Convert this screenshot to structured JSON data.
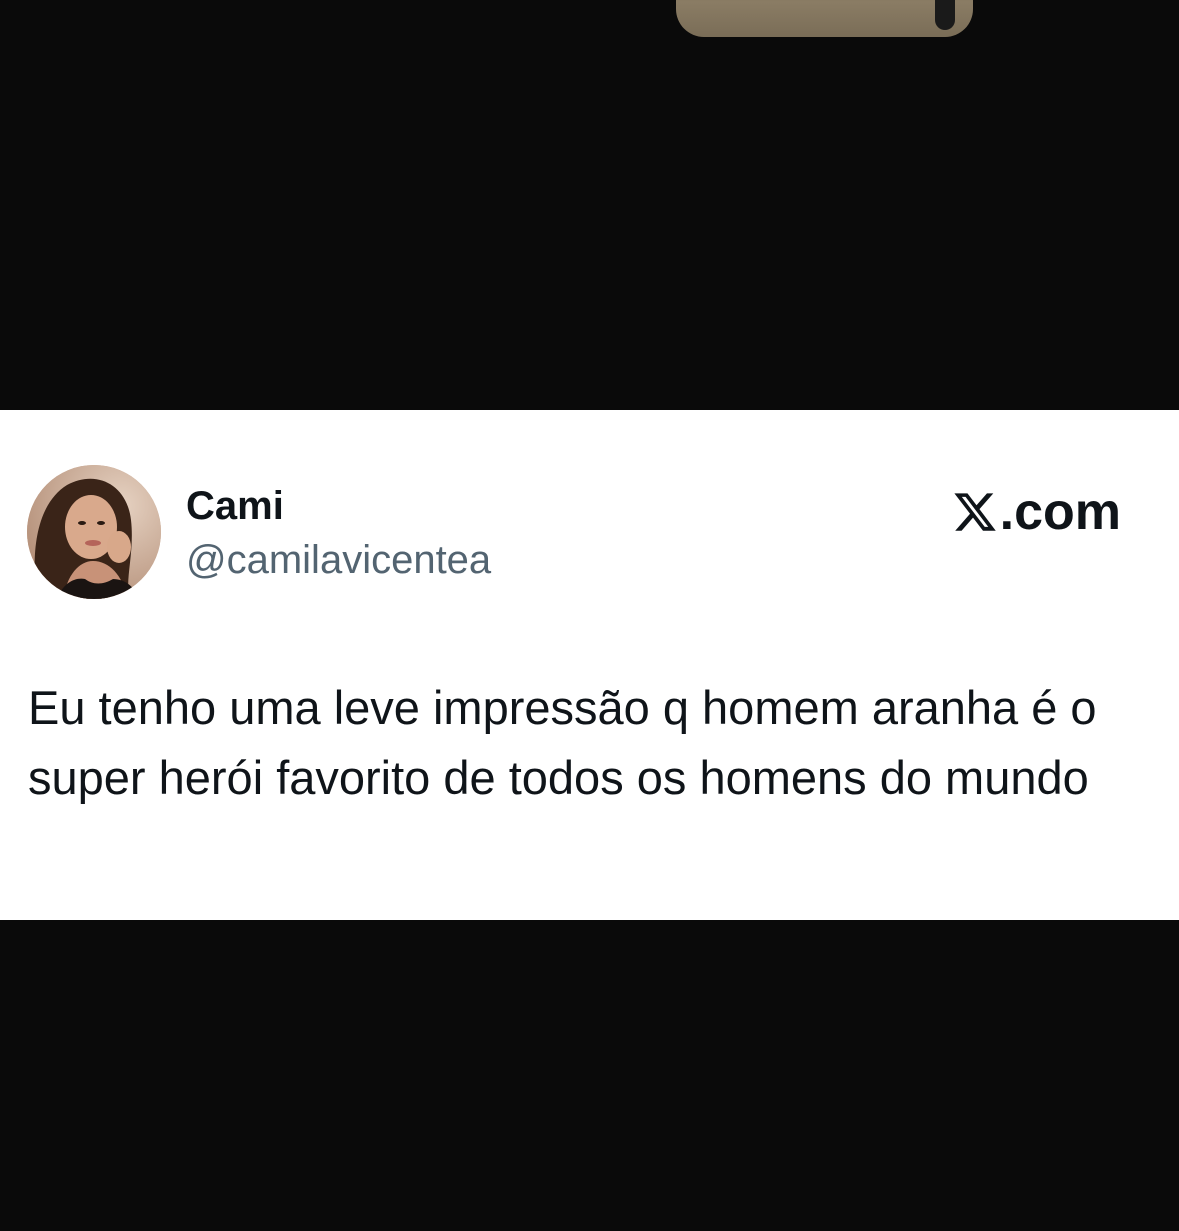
{
  "tweet": {
    "author_name": "Cami",
    "author_handle": "@camilavicentea",
    "brand_domain": ".com",
    "brand_icon": "x-logo-icon",
    "avatar_alt": "avatar",
    "text": "Eu tenho uma leve impressão q homem aranha é o super herói favorito de todos os homens do mundo"
  },
  "colors": {
    "background": "#0a0a0a",
    "card": "#ffffff",
    "name_text": "#0f1419",
    "handle_text": "#536471"
  }
}
